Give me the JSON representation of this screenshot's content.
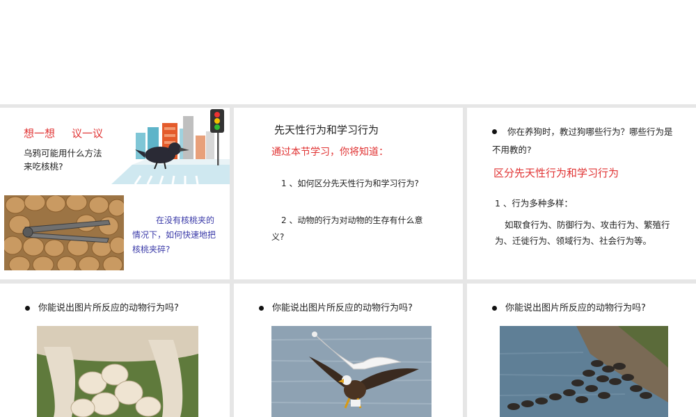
{
  "slide1": {
    "heading_left": "想一想",
    "heading_right": "议一议",
    "question": "乌鸦可能用什么方法来吃核桃?",
    "caption": "在没有核桃夹的情况下，如何快速地把核桃夹碎?"
  },
  "slide2": {
    "title": "先天性行为和学习行为",
    "subtitle": "通过本节学习，你将知道：",
    "item1": "1 、如何区分先天性行为和学习行为?",
    "item2": "2 、动物的行为对动物的生存有什么意义?"
  },
  "slide3": {
    "question": "你在养狗时，教过狗哪些行为？哪些行为是不用教的?",
    "highlight": "区分先天性行为和学习行为",
    "point1": "1 、行为多种多样：",
    "point1_detail": "如取食行为、防御行为、攻击行为、繁殖行为、迁徙行为、领域行为、社会行为等。"
  },
  "slide4": {
    "question": "你能说出图片所反应的动物行为吗?"
  },
  "slide5": {
    "question": "你能说出图片所反应的动物行为吗?"
  },
  "slide6": {
    "question": "你能说出图片所反应的动物行为吗?"
  },
  "colors": {
    "red": "#e03232",
    "blue": "#3a3aa8",
    "background": "#e6e6e6"
  },
  "icons": [
    "crow-city-illustration",
    "walnut-nutcracker-photo",
    "nursing-puppies-photo",
    "eagle-gull-photo",
    "wildebeest-river-photo"
  ]
}
